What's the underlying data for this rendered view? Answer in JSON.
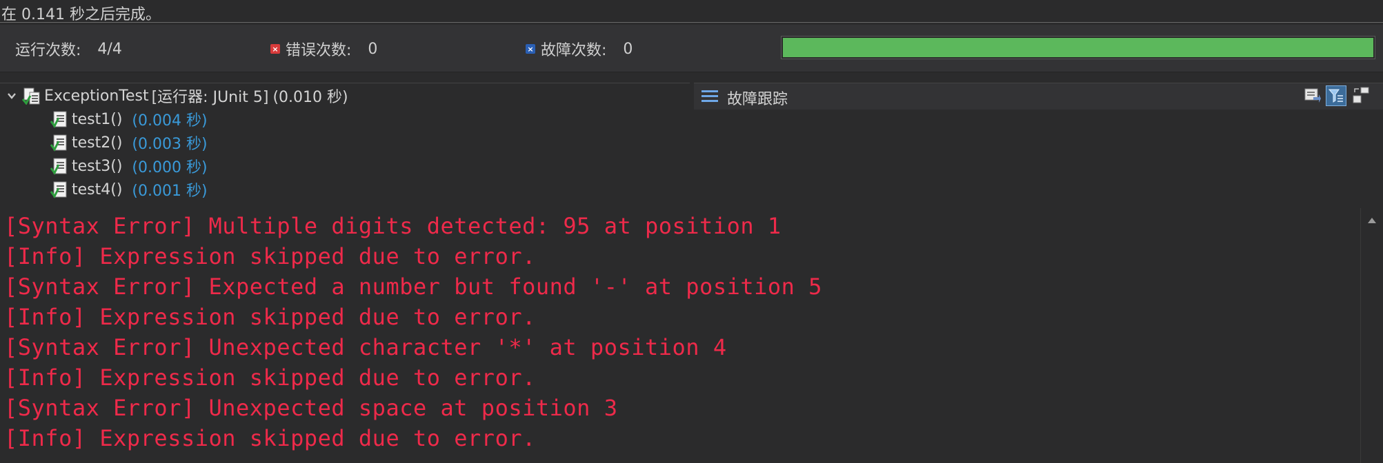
{
  "status": {
    "text": "在 0.141 秒之后完成。"
  },
  "counters": {
    "runs_label": "运行次数:",
    "runs_value": "4/4",
    "errors_label": "错误次数:",
    "errors_value": "0",
    "failures_label": "故障次数:",
    "failures_value": "0",
    "progress_percent": 100,
    "progress_color": "#5cb85c"
  },
  "tree": {
    "suite": {
      "name": "ExceptionTest",
      "runner": "[运行器: JUnit 5]",
      "time": "(0.010 秒)"
    },
    "tests": [
      {
        "name": "test1()",
        "time": "(0.004 秒)"
      },
      {
        "name": "test2()",
        "time": "(0.003 秒)"
      },
      {
        "name": "test3()",
        "time": "(0.000 秒)"
      },
      {
        "name": "test4()",
        "time": "(0.001 秒)"
      }
    ]
  },
  "trace": {
    "title": "故障跟踪"
  },
  "console": {
    "color": "#ee2a4a",
    "lines": [
      "[Syntax Error] Multiple digits detected: 95 at position 1",
      "[Info] Expression skipped due to error.",
      "[Syntax Error] Expected a number but found '-' at position 5",
      "[Info] Expression skipped due to error.",
      "[Syntax Error] Unexpected character '*' at position 4",
      "[Info] Expression skipped due to error.",
      "[Syntax Error] Unexpected space at position 3",
      "[Info] Expression skipped due to error."
    ]
  },
  "icons": {
    "error": "error-icon",
    "failure": "failure-icon",
    "suite": "test-suite-icon",
    "test_pass": "test-pass-icon",
    "trace_list": "list-icon",
    "compare": "compare-results-icon",
    "filter": "filter-stack-icon",
    "layout": "layout-icon"
  }
}
